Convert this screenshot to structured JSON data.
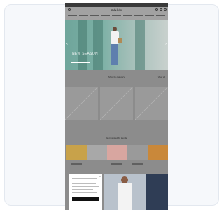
{
  "store": {
    "logo": "m&kdo"
  },
  "hero": {
    "title": "NEW SEASON"
  },
  "sections": {
    "featured_title": "Shop by category",
    "view_all": "View all",
    "inspiration_title": "Get inspired by trends"
  },
  "colors": {
    "overlay": "#8c8c8c",
    "hero_teal": "#7bb0a5",
    "modal_button": "#111111"
  },
  "icons": [
    "menu-icon",
    "search-icon",
    "user-icon",
    "bag-icon",
    "chevron-left-icon",
    "chevron-right-icon",
    "close-icon"
  ]
}
